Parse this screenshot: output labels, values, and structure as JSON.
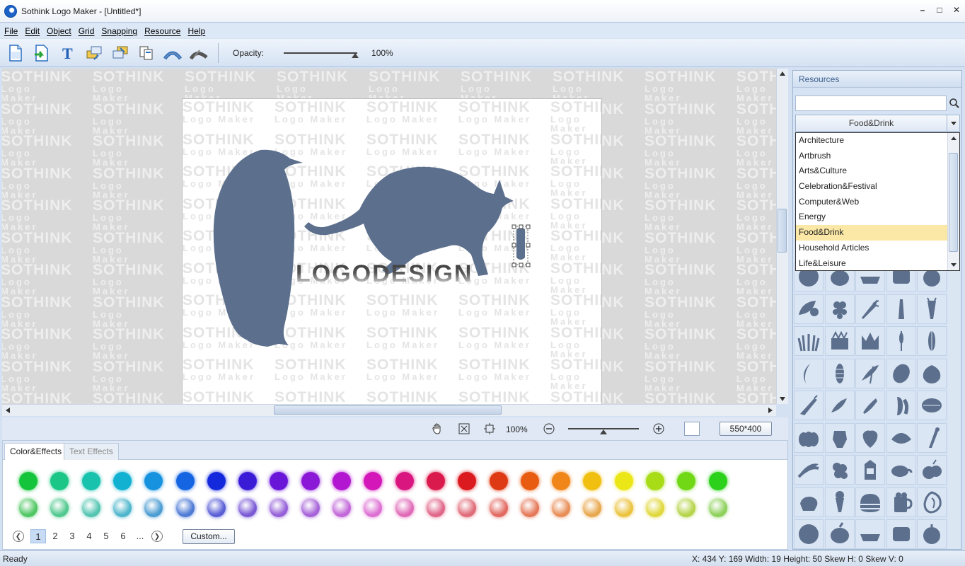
{
  "window": {
    "title": "Sothink Logo Maker - [Untitled*]"
  },
  "menu": [
    "File",
    "Edit",
    "Object",
    "Grid",
    "Snapping",
    "Resource",
    "Help"
  ],
  "toolbar": {
    "icons": [
      "new-file-icon",
      "open-file-icon",
      "text-tool-icon",
      "bring-front-icon",
      "send-back-icon",
      "copy-icon",
      "bend-up-icon",
      "bend-down-icon"
    ],
    "opacity_label": "Opacity:",
    "opacity_value": "100%",
    "opacity_level": 1.0
  },
  "canvas": {
    "watermark_line1": "SOTHINK",
    "watermark_line2": "Logo Maker",
    "logo_text": "LOGODESIGN",
    "shape_color": "#5c6f8c"
  },
  "zoombar": {
    "zoom_value": "100%",
    "zoom_level": 0.5,
    "canvas_size": "550*400"
  },
  "color_panel": {
    "tabs": [
      "Color&Effects",
      "Text Effects"
    ],
    "active_tab": 0,
    "colors_row1": [
      "#14c43a",
      "#1cc686",
      "#18c2ad",
      "#12b1d1",
      "#1692de",
      "#1565e3",
      "#1428dc",
      "#3a1cd6",
      "#6a16d9",
      "#8b18d6",
      "#b316d1",
      "#d317b8",
      "#d9157f",
      "#da1a4c",
      "#db1a1f",
      "#de3a13",
      "#e85c12",
      "#f0851a",
      "#f0bf0f",
      "#ebe615",
      "#a8dc16",
      "#70d815",
      "#2cd11b"
    ],
    "colors_row2": [
      "#4fc763",
      "#52c98f",
      "#55c5b2",
      "#4fb6cc",
      "#4d9dd2",
      "#4f7bd5",
      "#5a5fd6",
      "#7a5ad5",
      "#9560d8",
      "#a663d8",
      "#c268d8",
      "#dd70d3",
      "#e06ab8",
      "#e0668a",
      "#e06b79",
      "#e26a62",
      "#e5795a",
      "#e88e58",
      "#e8a84e",
      "#ebc33f",
      "#e0d83c",
      "#b6d44a",
      "#8ed15c"
    ],
    "pages": [
      "1",
      "2",
      "3",
      "4",
      "5",
      "6",
      "..."
    ],
    "active_page": 0,
    "custom_label": "Custom..."
  },
  "resources": {
    "header": "Resources",
    "search_value": "",
    "category_selected": "Food&Drink",
    "categories": [
      "Architecture",
      "Artbrush",
      "Arts&Culture",
      "Celebration&Festival",
      "Computer&Web",
      "Energy",
      "Food&Drink",
      "Household Articles",
      "Life&Leisure"
    ],
    "selected_index": 6,
    "icon_color": "#5c6f8c"
  },
  "status": {
    "ready": "Ready",
    "coords": "X: 434   Y: 169   Width: 19   Height: 50   Skew H: 0   Skew V: 0"
  }
}
